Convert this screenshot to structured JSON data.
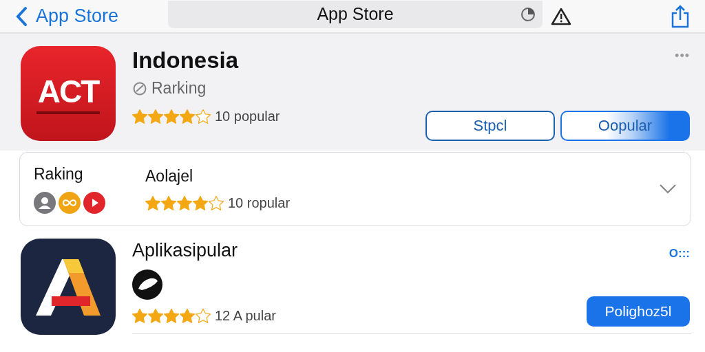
{
  "nav": {
    "back_label": "App Store",
    "title": "App Store"
  },
  "featured": {
    "icon_text": "ACT",
    "name": "Indonesia",
    "subtitle": "Rarking",
    "stars": 4,
    "rating_text": "10 popular",
    "more": "•••",
    "buttons": [
      {
        "label": "Stpcl",
        "kind": "outline"
      },
      {
        "label": "Oopular",
        "kind": "gradient"
      }
    ]
  },
  "ranking_card": {
    "label": "Raking",
    "title": "Aolajel",
    "stars": 4,
    "rating_text": "10 ropular",
    "expanded": false
  },
  "app": {
    "name": "Aplikasipular",
    "stars": 4,
    "rating_text": "12 A pular",
    "more": "O:::",
    "button": "Polighoz5l"
  }
}
